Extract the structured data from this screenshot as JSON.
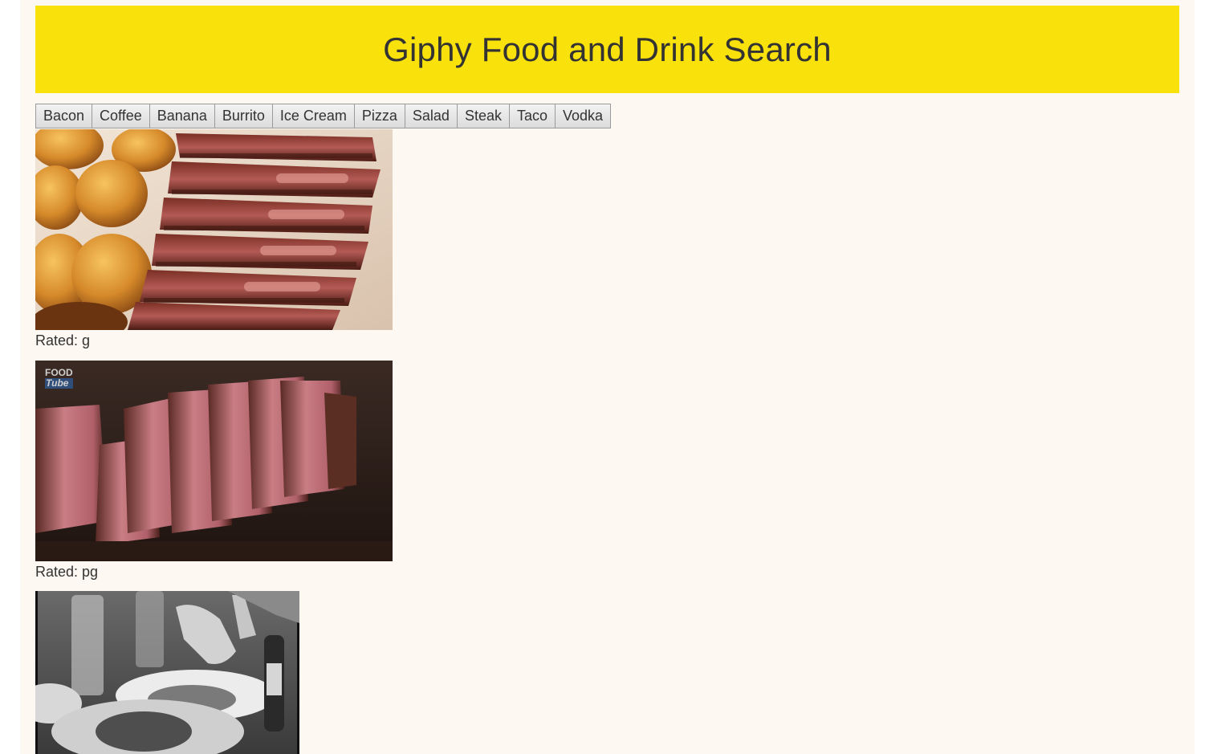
{
  "header": {
    "title": "Giphy Food and Drink Search"
  },
  "buttons": [
    "Bacon",
    "Coffee",
    "Banana",
    "Burrito",
    "Ice Cream",
    "Pizza",
    "Salad",
    "Steak",
    "Taco",
    "Vodka"
  ],
  "results": [
    {
      "rating_text": "Rated: g"
    },
    {
      "rating_text": "Rated: pg",
      "watermark_line1": "FOOD",
      "watermark_line2": "Tube"
    },
    {
      "rating_text": ""
    }
  ],
  "colors": {
    "header_bg": "#f9e20b",
    "page_bg": "#fdf8f2",
    "text": "#333333"
  }
}
